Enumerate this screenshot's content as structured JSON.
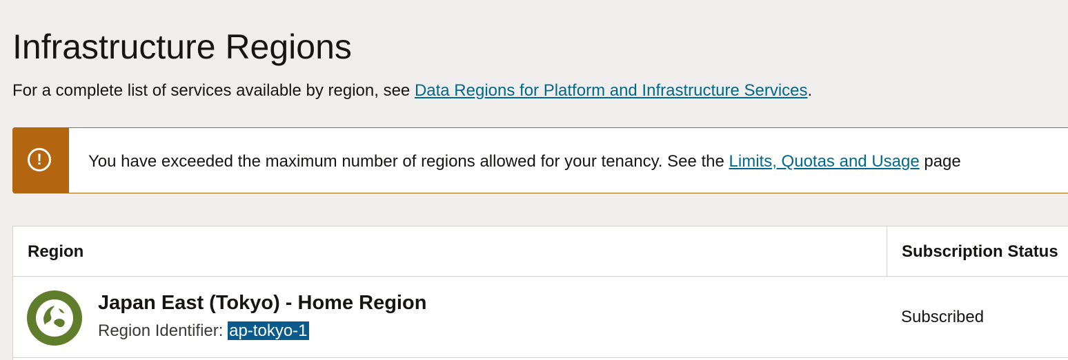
{
  "page": {
    "title": "Infrastructure Regions",
    "intro_prefix": "For a complete list of services available by region, see ",
    "intro_link": "Data Regions for Platform and Infrastructure Services",
    "intro_suffix": "."
  },
  "alert": {
    "icon": "exclamation-circle-icon",
    "text_prefix": "You have exceeded the maximum number of regions allowed for your tenancy. See the ",
    "link": "Limits, Quotas and Usage",
    "text_suffix": " page",
    "accent_color": "#b3650f"
  },
  "table": {
    "columns": {
      "region": "Region",
      "status": "Subscription Status"
    },
    "rows": [
      {
        "icon": "globe-icon",
        "name": "Japan East (Tokyo) - Home Region",
        "identifier_label": "Region Identifier: ",
        "identifier": "ap-tokyo-1",
        "status": "Subscribed",
        "icon_color": "#5f7d2b"
      }
    ]
  },
  "colors": {
    "link": "#00688c",
    "selection": "#0a5a8c"
  }
}
